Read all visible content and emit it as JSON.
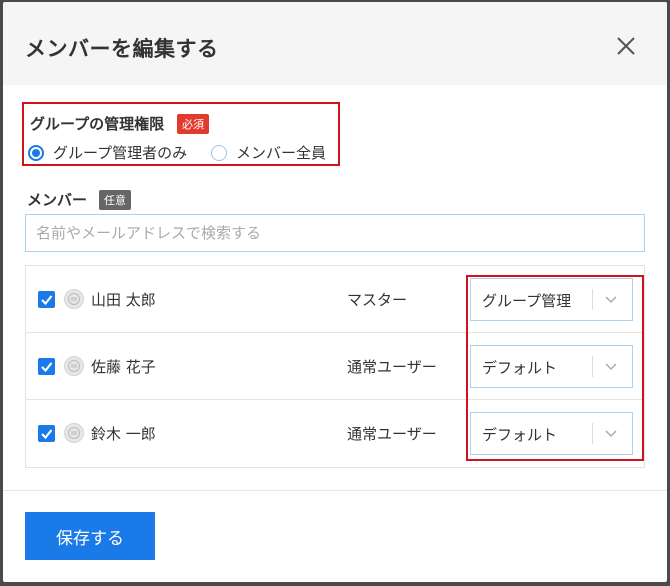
{
  "dialog": {
    "title": "メンバーを編集する"
  },
  "permission": {
    "label": "グループの管理権限",
    "required_badge": "必須",
    "options": [
      {
        "label": "グループ管理者のみ",
        "selected": true
      },
      {
        "label": "メンバー全員",
        "selected": false
      }
    ]
  },
  "members": {
    "label": "メンバー",
    "optional_badge": "任意",
    "search_placeholder": "名前やメールアドレスで検索する",
    "rows": [
      {
        "name": "山田 太郎",
        "role": "マスター",
        "checked": true,
        "permission": "グループ管理"
      },
      {
        "name": "佐藤 花子",
        "role": "通常ユーザー",
        "checked": true,
        "permission": "デフォルト"
      },
      {
        "name": "鈴木 一郎",
        "role": "通常ユーザー",
        "checked": true,
        "permission": "デフォルト"
      }
    ]
  },
  "footer": {
    "save_label": "保存する"
  },
  "colors": {
    "accent": "#1a7ae8",
    "highlight": "#d0131a",
    "required_badge": "#e23b2e",
    "optional_badge": "#666666"
  }
}
